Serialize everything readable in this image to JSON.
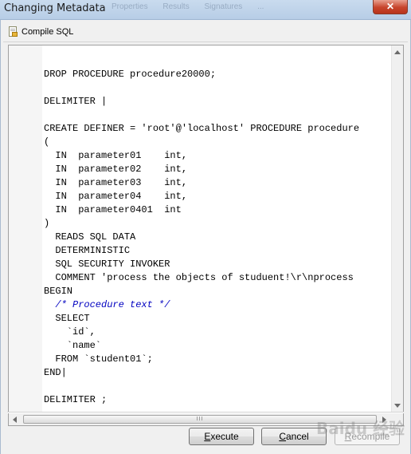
{
  "window": {
    "title": "Changing Metadata",
    "background_tabs": [
      "Properties",
      "Results",
      "Signatures",
      "..."
    ],
    "close_glyph": "✕"
  },
  "toolbar": {
    "compile_label": "Compile SQL",
    "compile_icon": "document-lock-icon"
  },
  "editor": {
    "lines": [
      "DROP PROCEDURE procedure20000;",
      "",
      "DELIMITER |",
      "",
      "CREATE DEFINER = 'root'@'localhost' PROCEDURE procedure",
      "(",
      "  IN  parameter01    int,",
      "  IN  parameter02    int,",
      "  IN  parameter03    int,",
      "  IN  parameter04    int,",
      "  IN  parameter0401  int",
      ")",
      "  READS SQL DATA",
      "  DETERMINISTIC",
      "  SQL SECURITY INVOKER",
      "  COMMENT 'process the objects of studuent!\\r\\nprocess",
      "BEGIN",
      "  /* Procedure text */",
      "  SELECT",
      "    `id`,",
      "    `name`",
      "  FROM `student01`;",
      "END|",
      "",
      "DELIMITER ;"
    ],
    "comment_line_index": 17
  },
  "scrollbar": {
    "thumb_grip": "III"
  },
  "buttons": {
    "execute": "Execute",
    "cancel": "Cancel",
    "recompile": "Recompile"
  },
  "watermark": "Baidu 经验",
  "colors": {
    "comment": "#0000c0",
    "close_button": "#c7442b"
  }
}
